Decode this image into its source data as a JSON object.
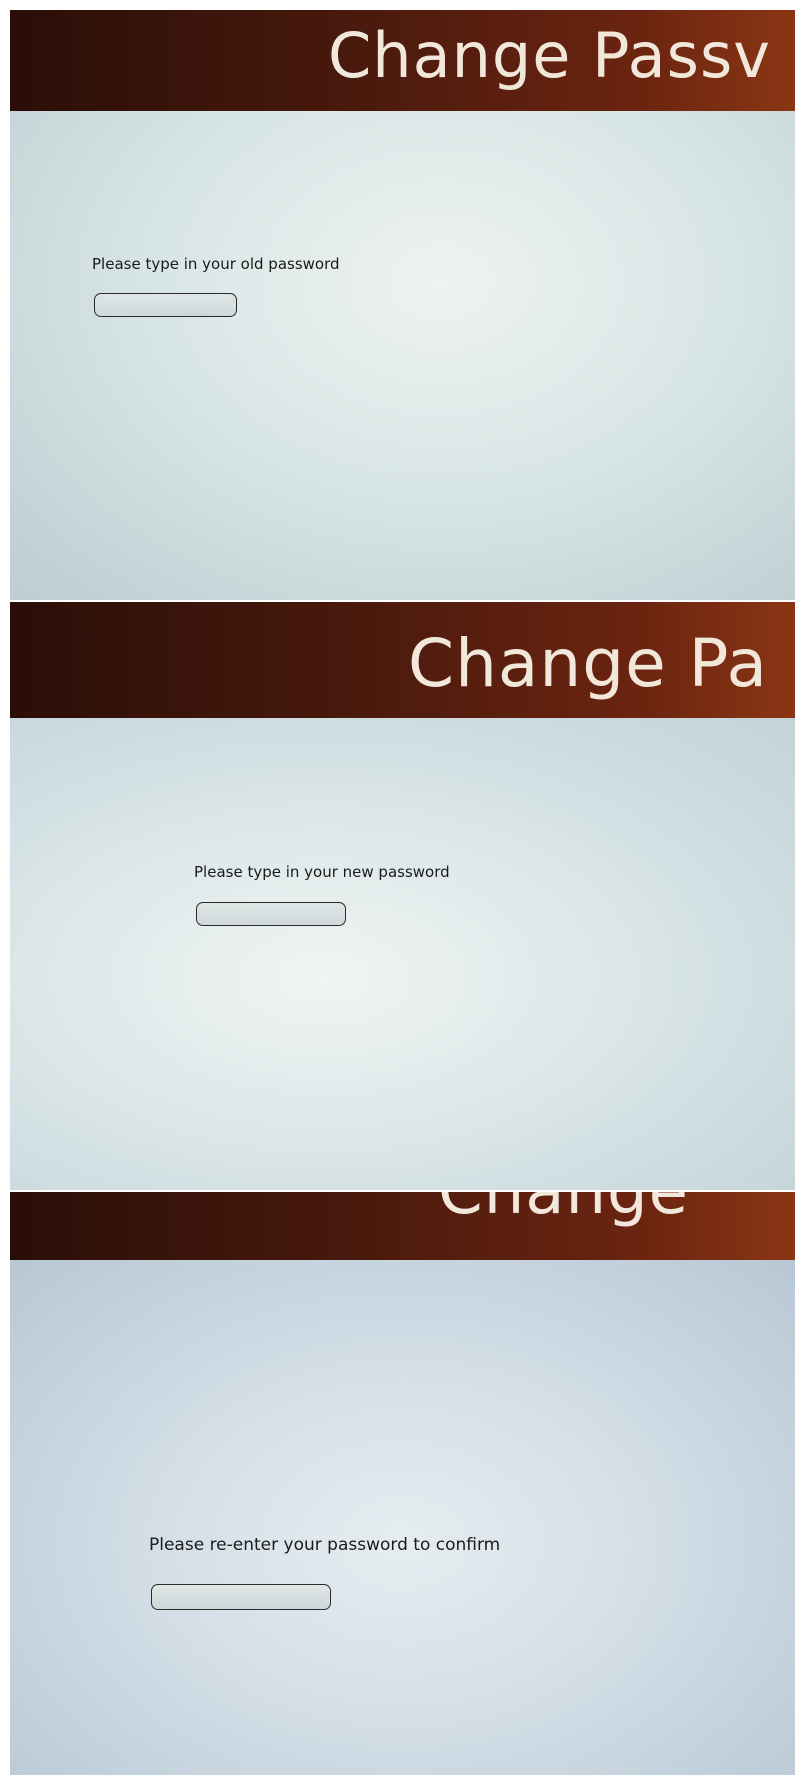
{
  "screens": [
    {
      "header_title": "Change Passv",
      "prompt": "Please type in your old password",
      "field_value": ""
    },
    {
      "header_title": "Change Pa",
      "prompt": "Please type in your new password",
      "field_value": ""
    },
    {
      "header_title": "Change",
      "prompt": "Please re-enter your password to confirm",
      "field_value": ""
    }
  ],
  "colors": {
    "header_dark": "#2a0e08",
    "header_accent": "#8a3614",
    "title_text": "#f1e7da",
    "content_background": "#dce7e8",
    "field_border": "#2a2a2a"
  }
}
